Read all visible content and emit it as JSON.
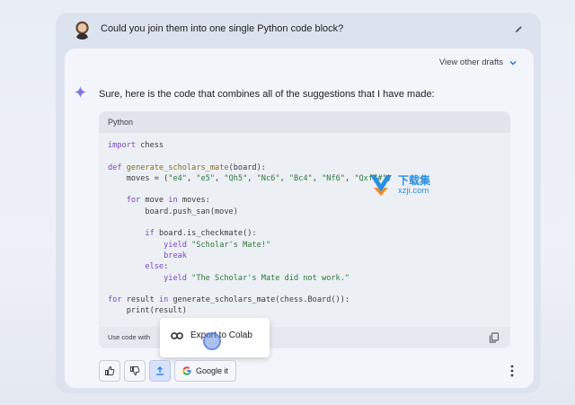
{
  "user": {
    "prompt": "Could you join them into one single Python code block?"
  },
  "answer": {
    "view_drafts": "View other drafts",
    "intro": "Sure, here is the code that combines all of the suggestions that I have made:",
    "code_language": "Python",
    "code_lines": [
      "import chess",
      "",
      "def generate_scholars_mate(board):",
      "    moves = (\"e4\", \"e5\", \"Qh5\", \"Nc6\", \"Bc4\", \"Nf6\", \"Qxf7#\")",
      "",
      "    for move in moves:",
      "        board.push_san(move)",
      "",
      "        if board.is_checkmate():",
      "            yield \"Scholar's Mate!\"",
      "            break",
      "        else:",
      "            yield \"The Scholar's Mate did not work.\"",
      "",
      "for result in generate_scholars_mate(chess.Board()):",
      "    print(result)"
    ],
    "code_footer": "Use code with",
    "export_label": "Export to Colab",
    "google_it": "Google it"
  },
  "watermark": {
    "cn": "下载集",
    "en": "xzji.com"
  },
  "colors": {
    "accent": "#1a73e8",
    "keyword": "#7b45c7",
    "string": "#2a7a3a"
  }
}
